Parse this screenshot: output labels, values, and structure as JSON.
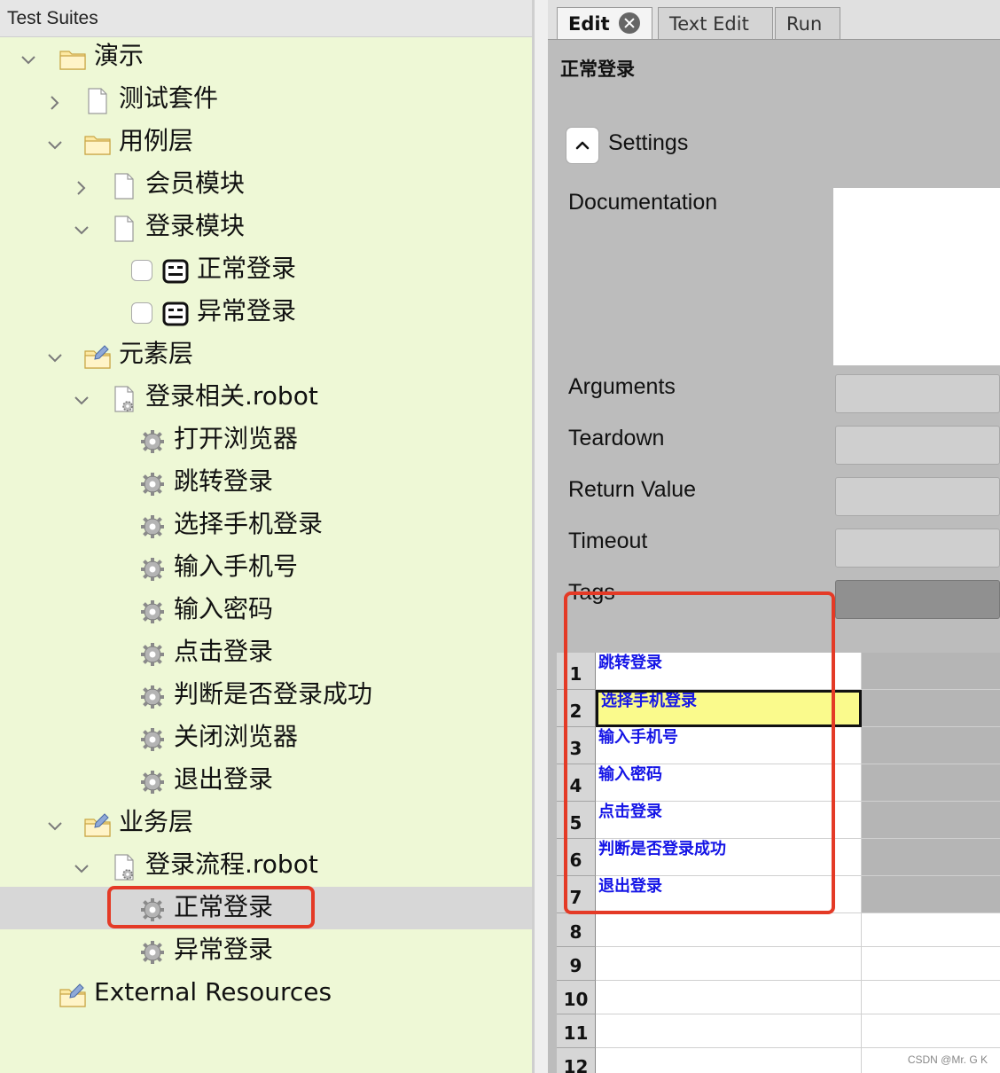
{
  "left_panel": {
    "title": "Test Suites",
    "tree": [
      {
        "label": "演示",
        "expanded": true,
        "icon": "folder-icon"
      },
      {
        "label": "测试套件",
        "expanded": false,
        "icon": "file-icon"
      },
      {
        "label": "用例层",
        "expanded": true,
        "icon": "folder-icon"
      },
      {
        "label": "会员模块",
        "expanded": false,
        "icon": "file-icon"
      },
      {
        "label": "登录模块",
        "expanded": true,
        "icon": "file-icon"
      },
      {
        "label": "正常登录",
        "icon": "robot-test-icon",
        "checked": false
      },
      {
        "label": "异常登录",
        "icon": "robot-test-icon",
        "checked": false
      },
      {
        "label": "元素层",
        "expanded": true,
        "icon": "resource-folder-icon"
      },
      {
        "label": "登录相关.robot",
        "expanded": true,
        "icon": "resource-file-icon"
      },
      {
        "label": "打开浏览器",
        "icon": "keyword-gear-icon"
      },
      {
        "label": "跳转登录",
        "icon": "keyword-gear-icon"
      },
      {
        "label": "选择手机登录",
        "icon": "keyword-gear-icon"
      },
      {
        "label": "输入手机号",
        "icon": "keyword-gear-icon"
      },
      {
        "label": "输入密码",
        "icon": "keyword-gear-icon"
      },
      {
        "label": "点击登录",
        "icon": "keyword-gear-icon"
      },
      {
        "label": "判断是否登录成功",
        "icon": "keyword-gear-icon"
      },
      {
        "label": "关闭浏览器",
        "icon": "keyword-gear-icon"
      },
      {
        "label": "退出登录",
        "icon": "keyword-gear-icon"
      },
      {
        "label": "业务层",
        "expanded": true,
        "icon": "resource-folder-icon"
      },
      {
        "label": "登录流程.robot",
        "expanded": true,
        "icon": "resource-file-icon"
      },
      {
        "label": "正常登录",
        "icon": "keyword-gear-icon",
        "selected": true
      },
      {
        "label": "异常登录",
        "icon": "keyword-gear-icon"
      },
      {
        "label": "External Resources",
        "icon": "resource-folder-icon"
      }
    ]
  },
  "right_panel": {
    "tabs": [
      {
        "label": "Edit",
        "active": true
      },
      {
        "label": "Text Edit",
        "active": false
      },
      {
        "label": "Run",
        "active": false
      }
    ],
    "keyword_title": "正常登录",
    "settings_label": "Settings",
    "fields": {
      "documentation": "Documentation",
      "arguments": "Arguments",
      "teardown": "Teardown",
      "return_value": "Return Value",
      "timeout": "Timeout",
      "tags": "Tags"
    },
    "grid": [
      {
        "num": "1",
        "step": "跳转登录"
      },
      {
        "num": "2",
        "step": "选择手机登录"
      },
      {
        "num": "3",
        "step": "输入手机号"
      },
      {
        "num": "4",
        "step": "输入密码"
      },
      {
        "num": "5",
        "step": "点击登录"
      },
      {
        "num": "6",
        "step": "判断是否登录成功"
      },
      {
        "num": "7",
        "step": "退出登录"
      },
      {
        "num": "8",
        "step": ""
      },
      {
        "num": "9",
        "step": ""
      },
      {
        "num": "10",
        "step": ""
      },
      {
        "num": "11",
        "step": ""
      },
      {
        "num": "12",
        "step": ""
      }
    ],
    "selected_row": "2"
  },
  "watermark": "CSDN @Mr. G K",
  "colors": {
    "tree_background": "#eef8d6",
    "keyword_text": "#1515e6",
    "highlight_cell": "#fafa8c",
    "annotation_red": "#e43a26"
  }
}
